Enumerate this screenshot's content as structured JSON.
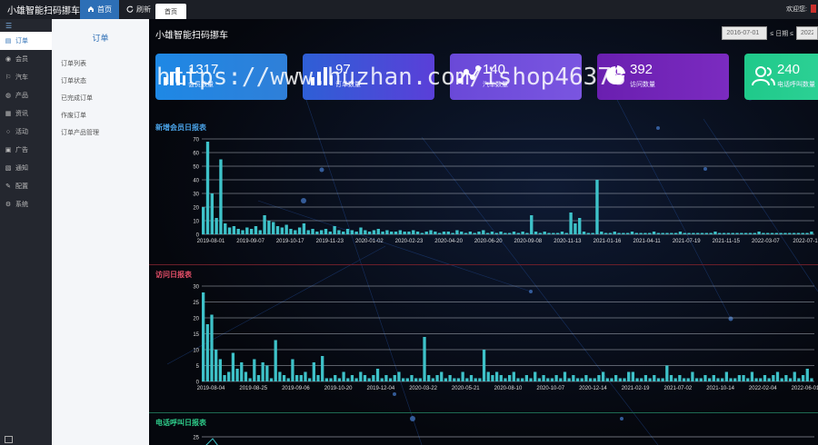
{
  "topbar": {
    "brand": "小雄智能扫码挪车",
    "nav": [
      {
        "label": "首页",
        "icon": "home-icon",
        "active": true
      },
      {
        "label": "刷新",
        "icon": "refresh-icon",
        "active": false
      }
    ],
    "page_tab": "首页",
    "welcome": "欢迎您:"
  },
  "sidebar": {
    "toggle_icon": "menu-icon",
    "items": [
      {
        "label": "订单",
        "icon": "order-icon",
        "active": true
      },
      {
        "label": "会员",
        "icon": "member-icon"
      },
      {
        "label": "汽车",
        "icon": "car-icon"
      },
      {
        "label": "产品",
        "icon": "product-icon"
      },
      {
        "label": "资讯",
        "icon": "news-icon"
      },
      {
        "label": "活动",
        "icon": "activity-icon"
      },
      {
        "label": "广告",
        "icon": "ad-icon"
      },
      {
        "label": "通知",
        "icon": "notice-icon"
      },
      {
        "label": "配置",
        "icon": "config-icon"
      },
      {
        "label": "系统",
        "icon": "system-icon"
      }
    ]
  },
  "submenu": {
    "title": "订单",
    "items": [
      "订单列表",
      "订单状态",
      "已完成订单",
      "作废订单",
      "订单产品管理"
    ]
  },
  "main": {
    "title": "小雄智能扫码挪车",
    "date_from": "2016-07-01",
    "date_sep": "≤ 日期 ≤",
    "date_to": "2022",
    "watermark": "https://www.huzhan.com/ishop46378"
  },
  "cards": [
    {
      "value": "1317",
      "label": "会员数量",
      "icon": "bar-chart-icon",
      "color_from": "#1e88e5",
      "color_to": "#2f7fd8"
    },
    {
      "value": "97",
      "label": "订单数量",
      "icon": "bar-chart-icon",
      "color_from": "#2e5fd6",
      "color_to": "#5a3fd8"
    },
    {
      "value": "140",
      "label": "汽车数量",
      "icon": "network-icon",
      "color_from": "#6a49d8",
      "color_to": "#7a55e0"
    },
    {
      "value": "392",
      "label": "访问数量",
      "icon": "pie-chart-icon",
      "color_from": "#6a1fb0",
      "color_to": "#7b2bc0"
    },
    {
      "value": "240",
      "label": "电话呼叫数量",
      "icon": "users-icon",
      "color_from": "#1fc98a",
      "color_to": "#36d69c"
    }
  ],
  "chart_data": [
    {
      "type": "bar",
      "title": "新增会员日报表",
      "title_color": "#4aa3e8",
      "ylim": [
        0,
        70
      ],
      "yticks": [
        0,
        10,
        20,
        30,
        40,
        50,
        60,
        70
      ],
      "xticks": [
        "2019-08-01",
        "2019-09-07",
        "2019-10-17",
        "2019-11-23",
        "2020-01-02",
        "2020-02-23",
        "2020-04-20",
        "2020-06-20",
        "2020-09-08",
        "2020-11-13",
        "2021-01-16",
        "2021-04-11",
        "2021-07-19",
        "2021-11-15",
        "2022-03-07",
        "2022-07-1"
      ],
      "values": [
        20,
        68,
        30,
        12,
        55,
        8,
        5,
        6,
        4,
        3,
        5,
        4,
        6,
        3,
        14,
        10,
        9,
        6,
        5,
        7,
        4,
        3,
        5,
        8,
        3,
        4,
        2,
        3,
        4,
        2,
        6,
        3,
        2,
        4,
        3,
        2,
        5,
        3,
        2,
        3,
        4,
        2,
        3,
        2,
        2,
        3,
        2,
        2,
        3,
        2,
        1,
        2,
        3,
        2,
        1,
        2,
        2,
        1,
        3,
        2,
        1,
        2,
        1,
        2,
        3,
        1,
        2,
        1,
        2,
        1,
        1,
        2,
        1,
        2,
        1,
        14,
        2,
        1,
        2,
        1,
        1,
        1,
        2,
        1,
        16,
        8,
        12,
        2,
        1,
        1,
        40,
        2,
        1,
        1,
        2,
        1,
        1,
        1,
        2,
        1,
        1,
        1,
        1,
        2,
        1,
        1,
        1,
        1,
        1,
        2,
        1,
        1,
        1,
        1,
        1,
        1,
        1,
        2,
        1,
        1,
        1,
        1,
        1,
        1,
        1,
        1,
        1,
        2,
        1,
        1,
        1,
        1,
        1,
        1,
        1,
        1,
        1,
        1,
        1,
        2
      ]
    },
    {
      "type": "bar",
      "title": "访问日报表",
      "title_color": "#e8506a",
      "ylim": [
        0,
        30
      ],
      "yticks": [
        0,
        5,
        10,
        15,
        20,
        25,
        30
      ],
      "xticks": [
        "2019-08-04",
        "2019-08-25",
        "2019-09-06",
        "2019-10-20",
        "2019-12-04",
        "2020-03-22",
        "2020-05-21",
        "2020-08-10",
        "2020-10-07",
        "2020-12-14",
        "2021-02-19",
        "2021-07-02",
        "2021-10-14",
        "2022-02-04",
        "2022-06-01"
      ],
      "values": [
        28,
        18,
        21,
        10,
        7,
        2,
        3,
        9,
        4,
        6,
        3,
        1,
        7,
        2,
        6,
        5,
        1,
        13,
        3,
        2,
        1,
        7,
        2,
        2,
        3,
        1,
        6,
        2,
        8,
        1,
        1,
        2,
        1,
        3,
        1,
        2,
        1,
        3,
        2,
        1,
        2,
        4,
        1,
        2,
        1,
        2,
        3,
        1,
        1,
        2,
        1,
        1,
        14,
        2,
        1,
        2,
        3,
        1,
        2,
        1,
        1,
        3,
        1,
        2,
        1,
        1,
        10,
        3,
        2,
        3,
        2,
        1,
        2,
        3,
        1,
        1,
        2,
        1,
        3,
        1,
        2,
        1,
        1,
        2,
        1,
        3,
        1,
        2,
        1,
        1,
        2,
        1,
        1,
        2,
        3,
        1,
        1,
        2,
        1,
        1,
        3,
        3,
        1,
        1,
        2,
        1,
        2,
        1,
        1,
        5,
        2,
        1,
        2,
        1,
        1,
        3,
        1,
        1,
        2,
        1,
        2,
        1,
        1,
        3,
        1,
        1,
        2,
        2,
        1,
        3,
        1,
        1,
        2,
        1,
        2,
        3,
        1,
        2,
        1,
        3,
        1,
        2,
        4,
        1
      ]
    },
    {
      "type": "line",
      "title": "电话呼叫日报表",
      "title_color": "#2ecc8a",
      "ylim": [
        0,
        25
      ],
      "yticks": [
        25
      ]
    }
  ]
}
